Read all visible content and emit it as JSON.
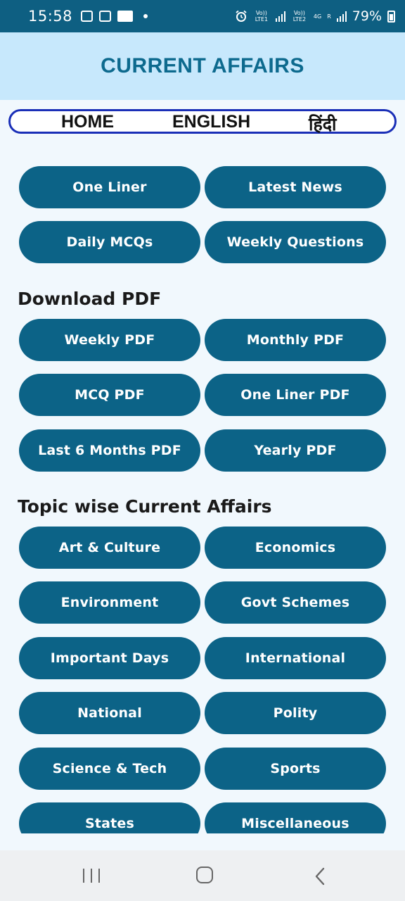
{
  "status_bar": {
    "time": "15:58",
    "sim1_label": "Vo)) LTE1",
    "sim2_label": "Vo)) LTE2",
    "data_label": "4G",
    "roaming_label": "R",
    "battery": "79%"
  },
  "header": {
    "title": "CURRENT AFFAIRS"
  },
  "nav": {
    "home": "HOME",
    "english": "ENGLISH",
    "hindi": "हिंदी"
  },
  "quick_links": [
    "One Liner",
    "Latest News",
    "Daily MCQs",
    "Weekly Questions"
  ],
  "download": {
    "title": "Download PDF",
    "items": [
      "Weekly PDF",
      "Monthly PDF",
      "MCQ PDF",
      "One Liner PDF",
      "Last 6 Months PDF",
      "Yearly PDF"
    ]
  },
  "topics": {
    "title": "Topic wise Current Affairs",
    "items": [
      "Art & Culture",
      "Economics",
      "Environment",
      "Govt Schemes",
      "Important Days",
      "International",
      "National",
      "Polity",
      "Science & Tech",
      "Sports",
      "States",
      "Miscellaneous"
    ]
  },
  "system_nav": {
    "icons": [
      "recent-apps-icon",
      "home-icon",
      "back-icon"
    ]
  },
  "colors": {
    "status_bar": "#0e5f82",
    "header_bg": "#c7e8fc",
    "title": "#0d6a8e",
    "button": "#0c6387",
    "nav_border": "#1a2fb7",
    "page_bg": "#f1f8fd"
  }
}
